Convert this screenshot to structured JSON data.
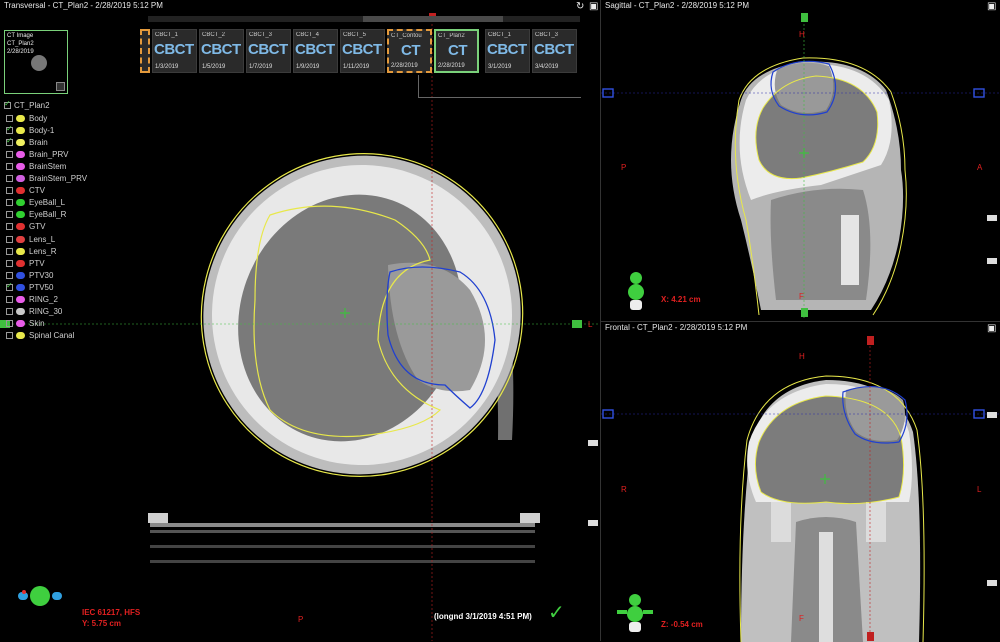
{
  "transversal": {
    "title": "Transversal - CT_Plan2 - 2/28/2019 5:12 PM",
    "preview": {
      "line1": "CT Image",
      "line2": "CT_Plan2",
      "line3": "2/28/2019"
    },
    "orient_bottom": "P",
    "orient_right": "L",
    "coord_iec": "IEC 61217, HFS",
    "coord_y": "Y: 5.75 cm",
    "approval": "(longnd 3/1/2019 4:51 PM)"
  },
  "thumbnails": [
    {
      "name": "CBCT_1",
      "big": "CBCT",
      "date": "1/3/2019",
      "state": "normal"
    },
    {
      "name": "CBCT_2",
      "big": "CBCT",
      "date": "1/5/2019",
      "state": "normal"
    },
    {
      "name": "CBCT_3",
      "big": "CBCT",
      "date": "1/7/2019",
      "state": "normal"
    },
    {
      "name": "CBCT_4",
      "big": "CBCT",
      "date": "1/9/2019",
      "state": "normal"
    },
    {
      "name": "CBCT_5",
      "big": "CBCT",
      "date": "1/11/2019",
      "state": "normal"
    },
    {
      "name": "CT_Contou",
      "big": "CT",
      "date": "2/28/2019",
      "state": "orange"
    },
    {
      "name": "CT_Plan2",
      "big": "CT",
      "date": "2/28/2019",
      "state": "green"
    },
    {
      "name": "CBCT_1",
      "big": "CBCT",
      "date": "3/1/2019",
      "state": "normal"
    },
    {
      "name": "CBCT_3",
      "big": "CBCT",
      "date": "3/4/2019",
      "state": "normal"
    }
  ],
  "structure_set": {
    "name": "CT_Plan2",
    "checked": true
  },
  "structures": [
    {
      "name": "Body",
      "color": "#e8e84a",
      "checked": false
    },
    {
      "name": "Body-1",
      "color": "#e8e84a",
      "checked": true
    },
    {
      "name": "Brain",
      "color": "#f0f060",
      "checked": true
    },
    {
      "name": "Brain_PRV",
      "color": "#e85ce8",
      "checked": false
    },
    {
      "name": "BrainStem",
      "color": "#e85ce8",
      "checked": false
    },
    {
      "name": "BrainStem_PRV",
      "color": "#d060e0",
      "checked": false
    },
    {
      "name": "CTV",
      "color": "#e03030",
      "checked": false
    },
    {
      "name": "EyeBall_L",
      "color": "#30d030",
      "checked": false
    },
    {
      "name": "EyeBall_R",
      "color": "#30d030",
      "checked": false
    },
    {
      "name": "GTV",
      "color": "#e03030",
      "checked": false
    },
    {
      "name": "Lens_L",
      "color": "#e04040",
      "checked": false
    },
    {
      "name": "Lens_R",
      "color": "#e8e84a",
      "checked": false
    },
    {
      "name": "PTV",
      "color": "#e03030",
      "checked": false
    },
    {
      "name": "PTV30",
      "color": "#3050e0",
      "checked": false
    },
    {
      "name": "PTV50",
      "color": "#3050e0",
      "checked": true
    },
    {
      "name": "RING_2",
      "color": "#e85ce8",
      "checked": false
    },
    {
      "name": "RING_30",
      "color": "#c8c8c8",
      "checked": false
    },
    {
      "name": "Skin",
      "color": "#e85ce8",
      "checked": false
    },
    {
      "name": "Spinal Canal",
      "color": "#e8e84a",
      "checked": false
    }
  ],
  "sagittal": {
    "title": "Sagittal - CT_Plan2 - 2/28/2019 5:12 PM",
    "orient_top": "H",
    "orient_left": "P",
    "orient_right": "A",
    "orient_bottom": "F",
    "coord": "X: 4.21 cm"
  },
  "frontal": {
    "title": "Frontal - CT_Plan2 - 2/28/2019 5:12 PM",
    "orient_top": "H",
    "orient_left": "R",
    "orient_right": "L",
    "orient_bottom": "F",
    "coord": "Z: -0.54 cm"
  },
  "colors": {
    "body_contour": "#e8e84a",
    "ptv": "#2040d0",
    "crosshair_green": "#3fbf3f",
    "crosshair_blue": "#2a2aa8",
    "crosshair_red": "#c02020",
    "label_red": "#e02020",
    "selected_green": "#7ad17a",
    "selected_orange": "#e49a3c"
  }
}
